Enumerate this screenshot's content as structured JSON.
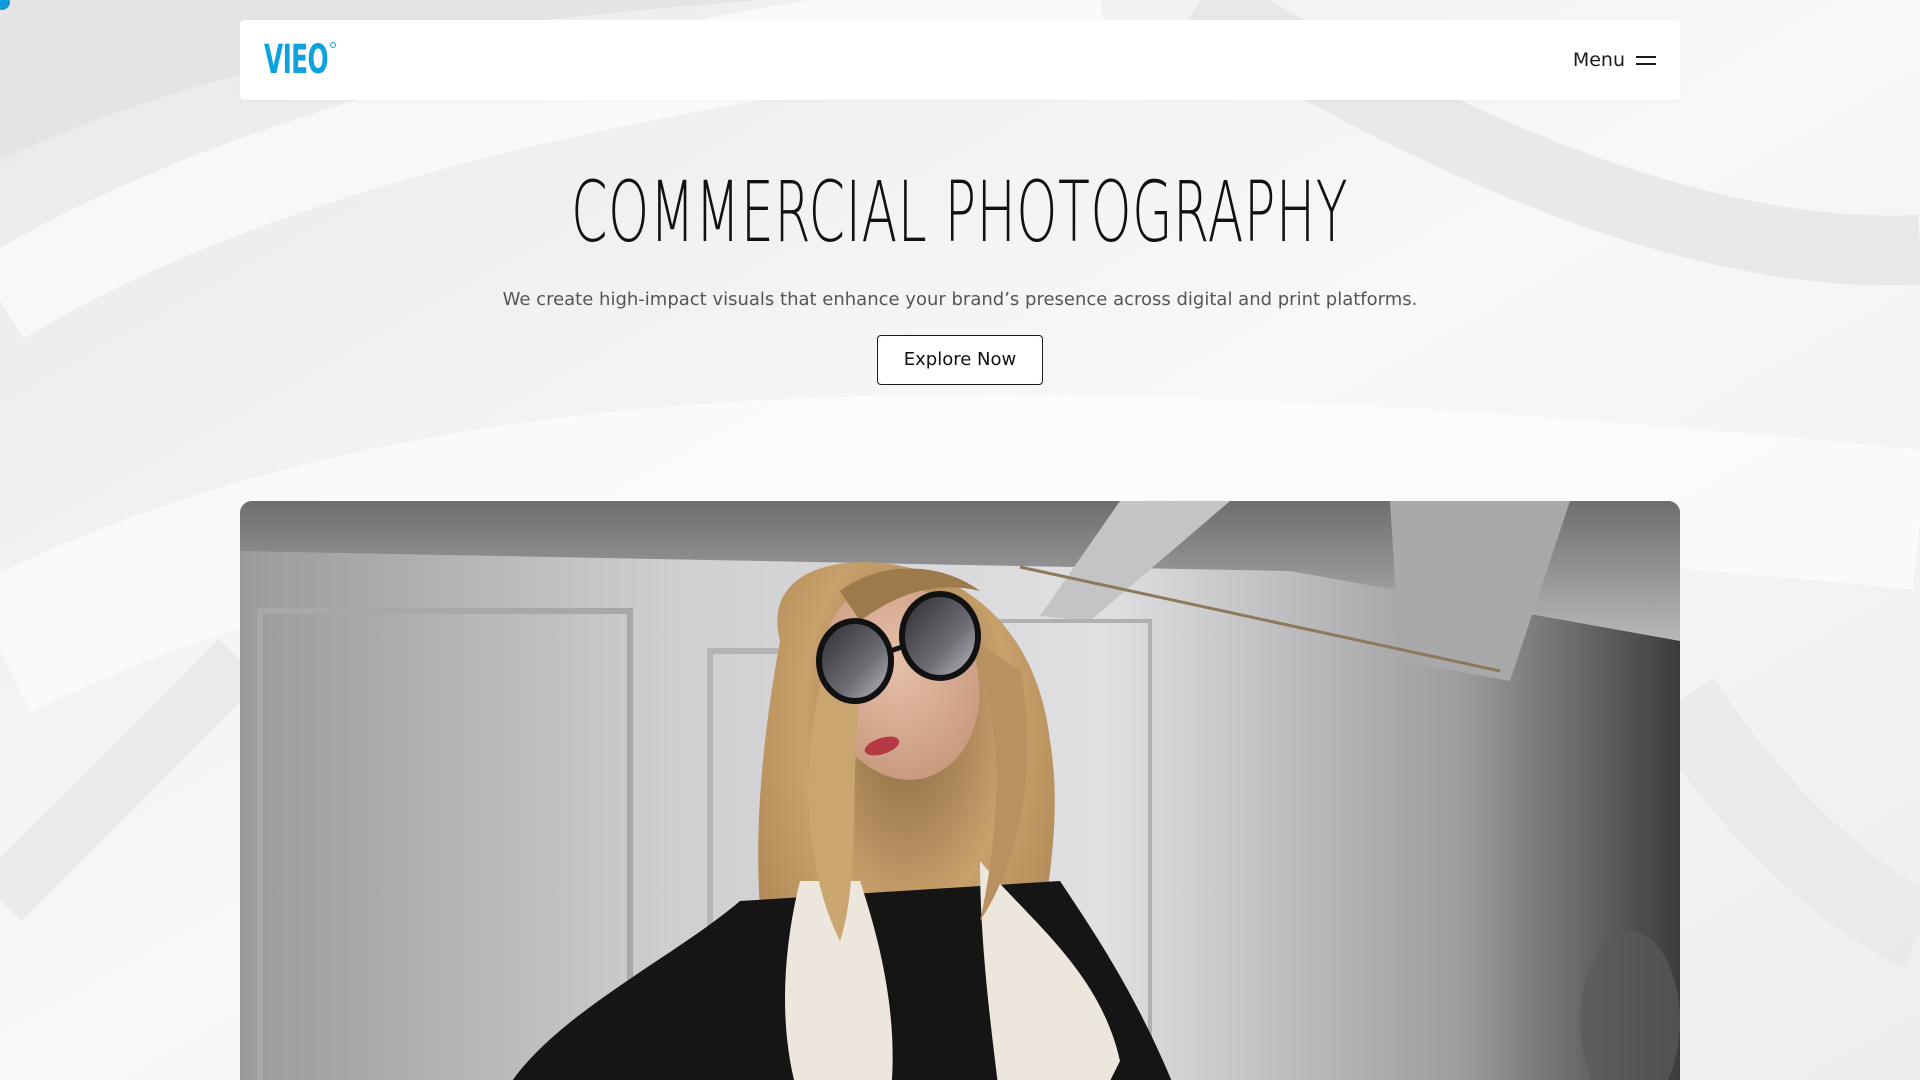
{
  "header": {
    "logo_text": "VIEO",
    "menu_label": "Menu",
    "menu_icon": "hamburger-icon"
  },
  "hero": {
    "title": "COMMERCIAL PHOTOGRAPHY",
    "subtitle": "We create high-impact visuals that enhance your brand’s presence across digital and print platforms.",
    "cta_label": "Explore Now"
  },
  "colors": {
    "brand": "#0ea3dc",
    "text": "#111111",
    "subtext": "#555555",
    "background": "#f3f3f4"
  }
}
